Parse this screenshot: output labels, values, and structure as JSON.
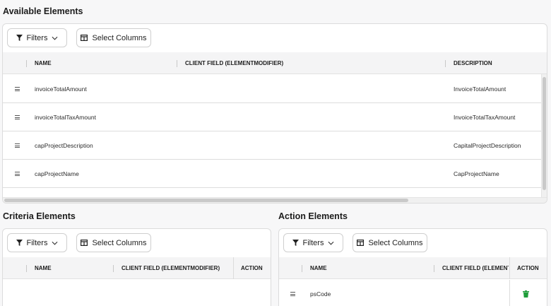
{
  "available": {
    "title": "Available Elements",
    "filters_label": "Filters",
    "select_columns_label": "Select Columns",
    "columns": [
      "NAME",
      "CLIENT FIELD (ELEMENTMODIFIER)",
      "DESCRIPTION"
    ],
    "rows": [
      {
        "name": "invoiceTotalAmount",
        "client_field": "",
        "description": "InvoiceTotalAmount"
      },
      {
        "name": "invoiceTotalTaxAmount",
        "client_field": "",
        "description": "InvoiceTotalTaxAmount"
      },
      {
        "name": "capProjectDescription",
        "client_field": "",
        "description": "CapitalProjectDescription"
      },
      {
        "name": "capProjectName",
        "client_field": "",
        "description": "CapProjectName"
      }
    ]
  },
  "criteria": {
    "title": "Criteria Elements",
    "filters_label": "Filters",
    "select_columns_label": "Select Columns",
    "columns": [
      "NAME",
      "CLIENT FIELD (ELEMENTMODIFIER)",
      "ACTION"
    ]
  },
  "action": {
    "title": "Action Elements",
    "filters_label": "Filters",
    "select_columns_label": "Select Columns",
    "columns": [
      "NAME",
      "CLIENT FIELD (ELEMENTMODIFIER)",
      "ACTION"
    ],
    "rows": [
      {
        "name": "psCode",
        "client_field": ""
      }
    ]
  },
  "colors": {
    "delete_icon": "#1f9d3a",
    "border": "#dcdcdc",
    "header_bg": "#f4f4f5"
  },
  "icons": [
    "filter-icon",
    "chevron-down-icon",
    "columns-icon",
    "drag-handle-icon",
    "trash-icon"
  ]
}
